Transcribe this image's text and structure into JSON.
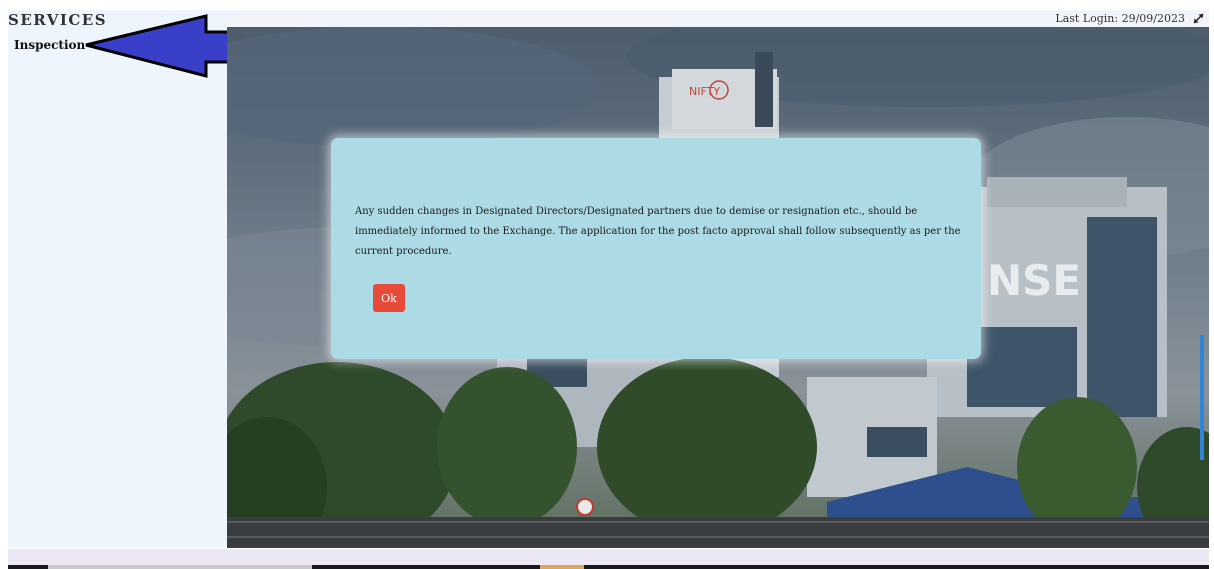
{
  "sidebar": {
    "title": "SERVICES",
    "items": [
      {
        "label": "Inspection"
      }
    ]
  },
  "header": {
    "last_login": "Last Login: 29/09/2023",
    "expand_icon": "expand-arrows-icon"
  },
  "background": {
    "description_icon": "nse-building-photo",
    "building_sign": "NSE",
    "logo_text": "NIFTY"
  },
  "modal": {
    "message": "Any sudden changes in Designated Directors/Designated partners due to demise or resignation etc., should be immediately informed to the Exchange. The application for the post facto approval shall follow subsequently as per the current procedure.",
    "ok_label": "Ok"
  },
  "colors": {
    "modal_bg": "#acdbe5",
    "ok_button": "#e84a3a",
    "annotation_arrow": "#3a3fc9",
    "sidebar_bg": "#eef5fc"
  }
}
